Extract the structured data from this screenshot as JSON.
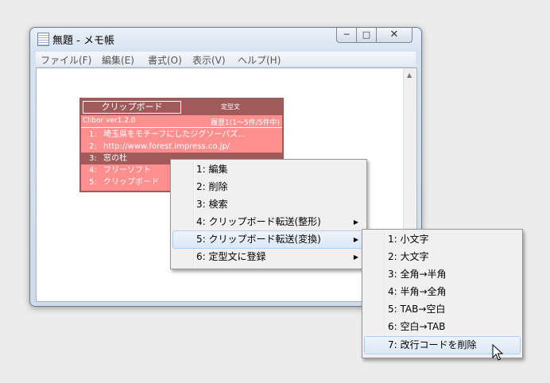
{
  "window": {
    "title": "無題 - メモ帳",
    "buttons": {
      "minimize": "─",
      "maximize": "□",
      "close": "✕"
    },
    "menu": [
      "ファイル(F)",
      "編集(E)",
      "書式(O)",
      "表示(V)",
      "ヘルプ(H)"
    ]
  },
  "clibor": {
    "tabs": {
      "active": "クリップボード",
      "other": "定型文"
    },
    "version": "Clibor ver1.2.0",
    "history_count": "履歴1(1〜5件/5件中)",
    "items": [
      {
        "num": "1:",
        "text": "埼玉県をモチーフにしたジグソーパズ..."
      },
      {
        "num": "2:",
        "text": "http://www.forest.impress.co.jp/"
      },
      {
        "num": "3:",
        "text": "窓の杜"
      },
      {
        "num": "4:",
        "text": "フリーソフト"
      },
      {
        "num": "5:",
        "text": "クリップボード"
      }
    ],
    "colors": {
      "background": "#ff8f8f",
      "selected": "#a05a5a",
      "border": "#a05a5a"
    }
  },
  "context_menu": {
    "items": [
      {
        "label": "1: 編集",
        "submenu": false
      },
      {
        "label": "2: 削除",
        "submenu": false
      },
      {
        "label": "3: 検索",
        "submenu": false
      },
      {
        "label": "4: クリップボード転送(整形)",
        "submenu": true
      },
      {
        "label": "5: クリップボード転送(変換)",
        "submenu": true
      },
      {
        "label": "6: 定型文に登録",
        "submenu": true
      }
    ]
  },
  "submenu": {
    "items": [
      {
        "label": "1: 小文字"
      },
      {
        "label": "2: 大文字"
      },
      {
        "label": "3: 全角→半角"
      },
      {
        "label": "4: 半角→全角"
      },
      {
        "label": "5: TAB→空白"
      },
      {
        "label": "6: 空白→TAB"
      },
      {
        "label": "7: 改行コードを削除"
      }
    ]
  }
}
